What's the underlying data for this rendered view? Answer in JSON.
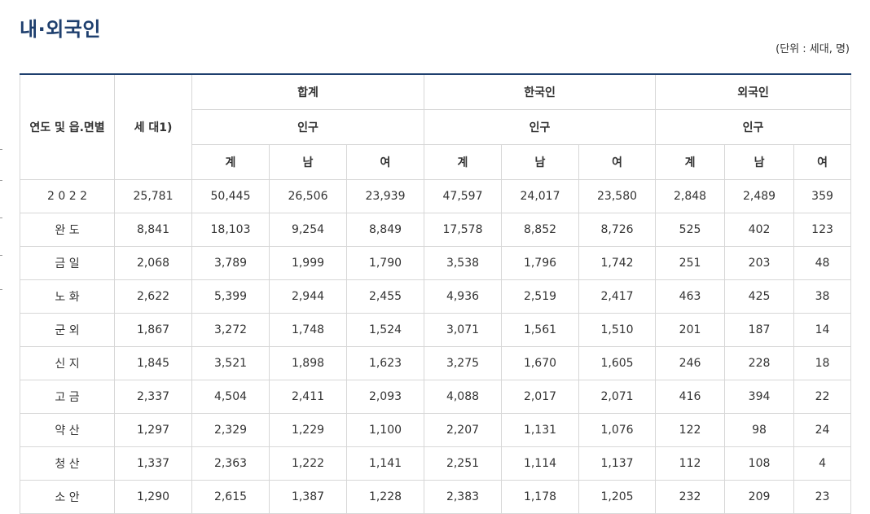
{
  "title": "내·외국인",
  "unit": "(단위 : 세대, 명)",
  "table": {
    "header": {
      "region": "연도 및 읍.면별",
      "households": "세 대1)",
      "group_total": "합계",
      "group_korean": "한국인",
      "group_foreign": "외국인",
      "population": "인구",
      "sum": "계",
      "male": "남",
      "female": "여"
    },
    "rows": [
      {
        "region": "2 0 2 2",
        "hh": "25,781",
        "t_sum": "50,445",
        "t_m": "26,506",
        "t_f": "23,939",
        "k_sum": "47,597",
        "k_m": "24,017",
        "k_f": "23,580",
        "f_sum": "2,848",
        "f_m": "2,489",
        "f_f": "359"
      },
      {
        "region": "완 도",
        "hh": "8,841",
        "t_sum": "18,103",
        "t_m": "9,254",
        "t_f": "8,849",
        "k_sum": "17,578",
        "k_m": "8,852",
        "k_f": "8,726",
        "f_sum": "525",
        "f_m": "402",
        "f_f": "123"
      },
      {
        "region": "금 일",
        "hh": "2,068",
        "t_sum": "3,789",
        "t_m": "1,999",
        "t_f": "1,790",
        "k_sum": "3,538",
        "k_m": "1,796",
        "k_f": "1,742",
        "f_sum": "251",
        "f_m": "203",
        "f_f": "48"
      },
      {
        "region": "노 화",
        "hh": "2,622",
        "t_sum": "5,399",
        "t_m": "2,944",
        "t_f": "2,455",
        "k_sum": "4,936",
        "k_m": "2,519",
        "k_f": "2,417",
        "f_sum": "463",
        "f_m": "425",
        "f_f": "38"
      },
      {
        "region": "군 외",
        "hh": "1,867",
        "t_sum": "3,272",
        "t_m": "1,748",
        "t_f": "1,524",
        "k_sum": "3,071",
        "k_m": "1,561",
        "k_f": "1,510",
        "f_sum": "201",
        "f_m": "187",
        "f_f": "14"
      },
      {
        "region": "신 지",
        "hh": "1,845",
        "t_sum": "3,521",
        "t_m": "1,898",
        "t_f": "1,623",
        "k_sum": "3,275",
        "k_m": "1,670",
        "k_f": "1,605",
        "f_sum": "246",
        "f_m": "228",
        "f_f": "18"
      },
      {
        "region": "고 금",
        "hh": "2,337",
        "t_sum": "4,504",
        "t_m": "2,411",
        "t_f": "2,093",
        "k_sum": "4,088",
        "k_m": "2,017",
        "k_f": "2,071",
        "f_sum": "416",
        "f_m": "394",
        "f_f": "22"
      },
      {
        "region": "약 산",
        "hh": "1,297",
        "t_sum": "2,329",
        "t_m": "1,229",
        "t_f": "1,100",
        "k_sum": "2,207",
        "k_m": "1,131",
        "k_f": "1,076",
        "f_sum": "122",
        "f_m": "98",
        "f_f": "24"
      },
      {
        "region": "청 산",
        "hh": "1,337",
        "t_sum": "2,363",
        "t_m": "1,222",
        "t_f": "1,141",
        "k_sum": "2,251",
        "k_m": "1,114",
        "k_f": "1,137",
        "f_sum": "112",
        "f_m": "108",
        "f_f": "4"
      },
      {
        "region": "소 안",
        "hh": "1,290",
        "t_sum": "2,615",
        "t_m": "1,387",
        "t_f": "1,228",
        "k_sum": "2,383",
        "k_m": "1,178",
        "k_f": "1,205",
        "f_sum": "232",
        "f_m": "209",
        "f_f": "23"
      }
    ]
  },
  "colors": {
    "title": "#1e3f6e",
    "header_rule": "#1e3f6e",
    "grid": "#d7d7d7"
  }
}
